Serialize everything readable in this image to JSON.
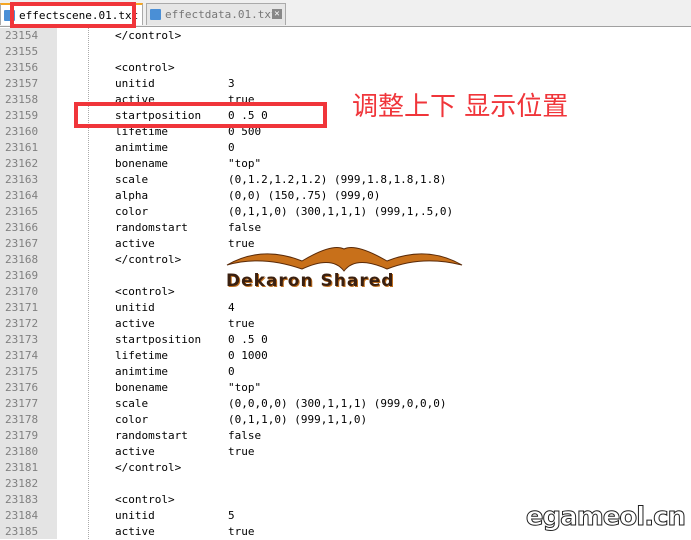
{
  "tabs": [
    {
      "label": "effectscene.01.txt",
      "active": true
    },
    {
      "label": "effectdata.01.txt",
      "active": false
    }
  ],
  "annotation": "调整上下 显示位置",
  "logo_text": "Dekaron Shared",
  "watermark": "egameol.cn",
  "colors": {
    "highlight": "#f0353a",
    "gutter": "#e4e4e4"
  },
  "lines": [
    {
      "n": "23154",
      "k": "</control>",
      "v": ""
    },
    {
      "n": "23155",
      "k": "",
      "v": ""
    },
    {
      "n": "23156",
      "k": "<control>",
      "v": ""
    },
    {
      "n": "23157",
      "k": "unitid",
      "v": "3"
    },
    {
      "n": "23158",
      "k": "active",
      "v": "true"
    },
    {
      "n": "23159",
      "k": "startposition",
      "v": "0 .5 0"
    },
    {
      "n": "23160",
      "k": "lifetime",
      "v": "0 500"
    },
    {
      "n": "23161",
      "k": "animtime",
      "v": "0"
    },
    {
      "n": "23162",
      "k": "bonename",
      "v": "\"top\""
    },
    {
      "n": "23163",
      "k": "scale",
      "v": "(0,1.2,1.2,1.2) (999,1.8,1.8,1.8)"
    },
    {
      "n": "23164",
      "k": "alpha",
      "v": "(0,0) (150,.75) (999,0)"
    },
    {
      "n": "23165",
      "k": "color",
      "v": "(0,1,1,0) (300,1,1,1) (999,1,.5,0)"
    },
    {
      "n": "23166",
      "k": "randomstart",
      "v": "false"
    },
    {
      "n": "23167",
      "k": "active",
      "v": "true"
    },
    {
      "n": "23168",
      "k": "</control>",
      "v": ""
    },
    {
      "n": "23169",
      "k": "",
      "v": ""
    },
    {
      "n": "23170",
      "k": "<control>",
      "v": ""
    },
    {
      "n": "23171",
      "k": "unitid",
      "v": "4"
    },
    {
      "n": "23172",
      "k": "active",
      "v": "true"
    },
    {
      "n": "23173",
      "k": "startposition",
      "v": "0 .5 0"
    },
    {
      "n": "23174",
      "k": "lifetime",
      "v": "0 1000"
    },
    {
      "n": "23175",
      "k": "animtime",
      "v": "0"
    },
    {
      "n": "23176",
      "k": "bonename",
      "v": "\"top\""
    },
    {
      "n": "23177",
      "k": "scale",
      "v": "(0,0,0,0) (300,1,1,1) (999,0,0,0)"
    },
    {
      "n": "23178",
      "k": "color",
      "v": "(0,1,1,0) (999,1,1,0)"
    },
    {
      "n": "23179",
      "k": "randomstart",
      "v": "false"
    },
    {
      "n": "23180",
      "k": "active",
      "v": "true"
    },
    {
      "n": "23181",
      "k": "</control>",
      "v": ""
    },
    {
      "n": "23182",
      "k": "",
      "v": ""
    },
    {
      "n": "23183",
      "k": "<control>",
      "v": ""
    },
    {
      "n": "23184",
      "k": "unitid",
      "v": "5"
    },
    {
      "n": "23185",
      "k": "active",
      "v": "true"
    }
  ]
}
